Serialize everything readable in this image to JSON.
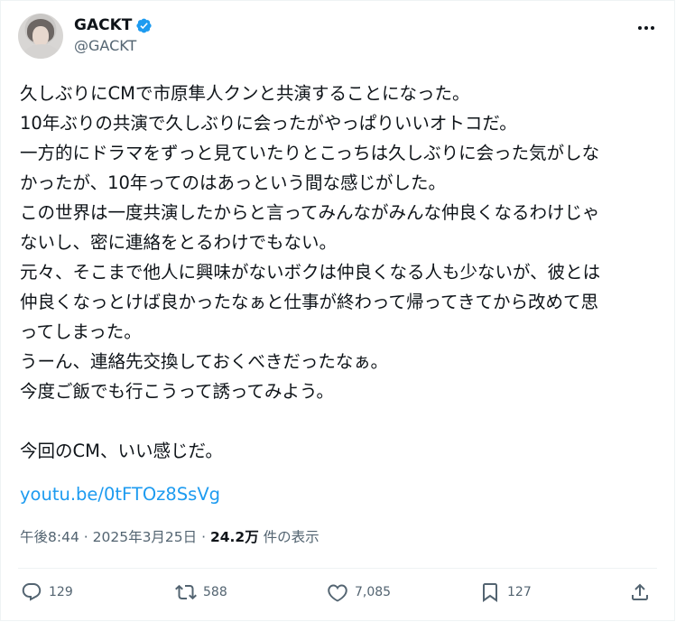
{
  "author": {
    "display_name": "GACKT",
    "handle": "@GACKT"
  },
  "tweet": {
    "lines": [
      "久しぶりにCMで市原隼人クンと共演することになった。",
      "10年ぶりの共演で久しぶりに会ったがやっぱりいいオトコだ。",
      "一方的にドラマをずっと見ていたりとこっちは久しぶりに会った気がしな",
      "かったが、10年ってのはあっという間な感じがした。",
      "この世界は一度共演したからと言ってみんながみんな仲良くなるわけじゃ",
      "ないし、密に連絡をとるわけでもない。",
      "元々、そこまで他人に興味がないボクは仲良くなる人も少ないが、彼とは",
      "仲良くなっとけば良かったなぁと仕事が終わって帰ってきてから改めて思",
      "ってしまった。",
      "うーん、連絡先交換しておくべきだったなぁ。",
      "今度ご飯でも行こうって誘ってみよう。",
      "",
      "今回のCM、いい感じだ。"
    ],
    "link": "youtu.be/0tFTOz8SsVg"
  },
  "meta": {
    "time": "午後8:44",
    "separator": "·",
    "date": "2025年3月25日",
    "views_count": "24.2万",
    "views_label": "件の表示"
  },
  "actions": {
    "replies": "129",
    "reposts": "588",
    "likes": "7,085",
    "bookmarks": "127"
  },
  "icons": [
    "verified-badge-icon",
    "more-icon",
    "reply-icon",
    "repost-icon",
    "like-icon",
    "bookmark-icon",
    "share-icon"
  ],
  "colors": {
    "link": "#1d9bf0",
    "secondary_text": "#536471",
    "verified": "#1d9bf0"
  }
}
